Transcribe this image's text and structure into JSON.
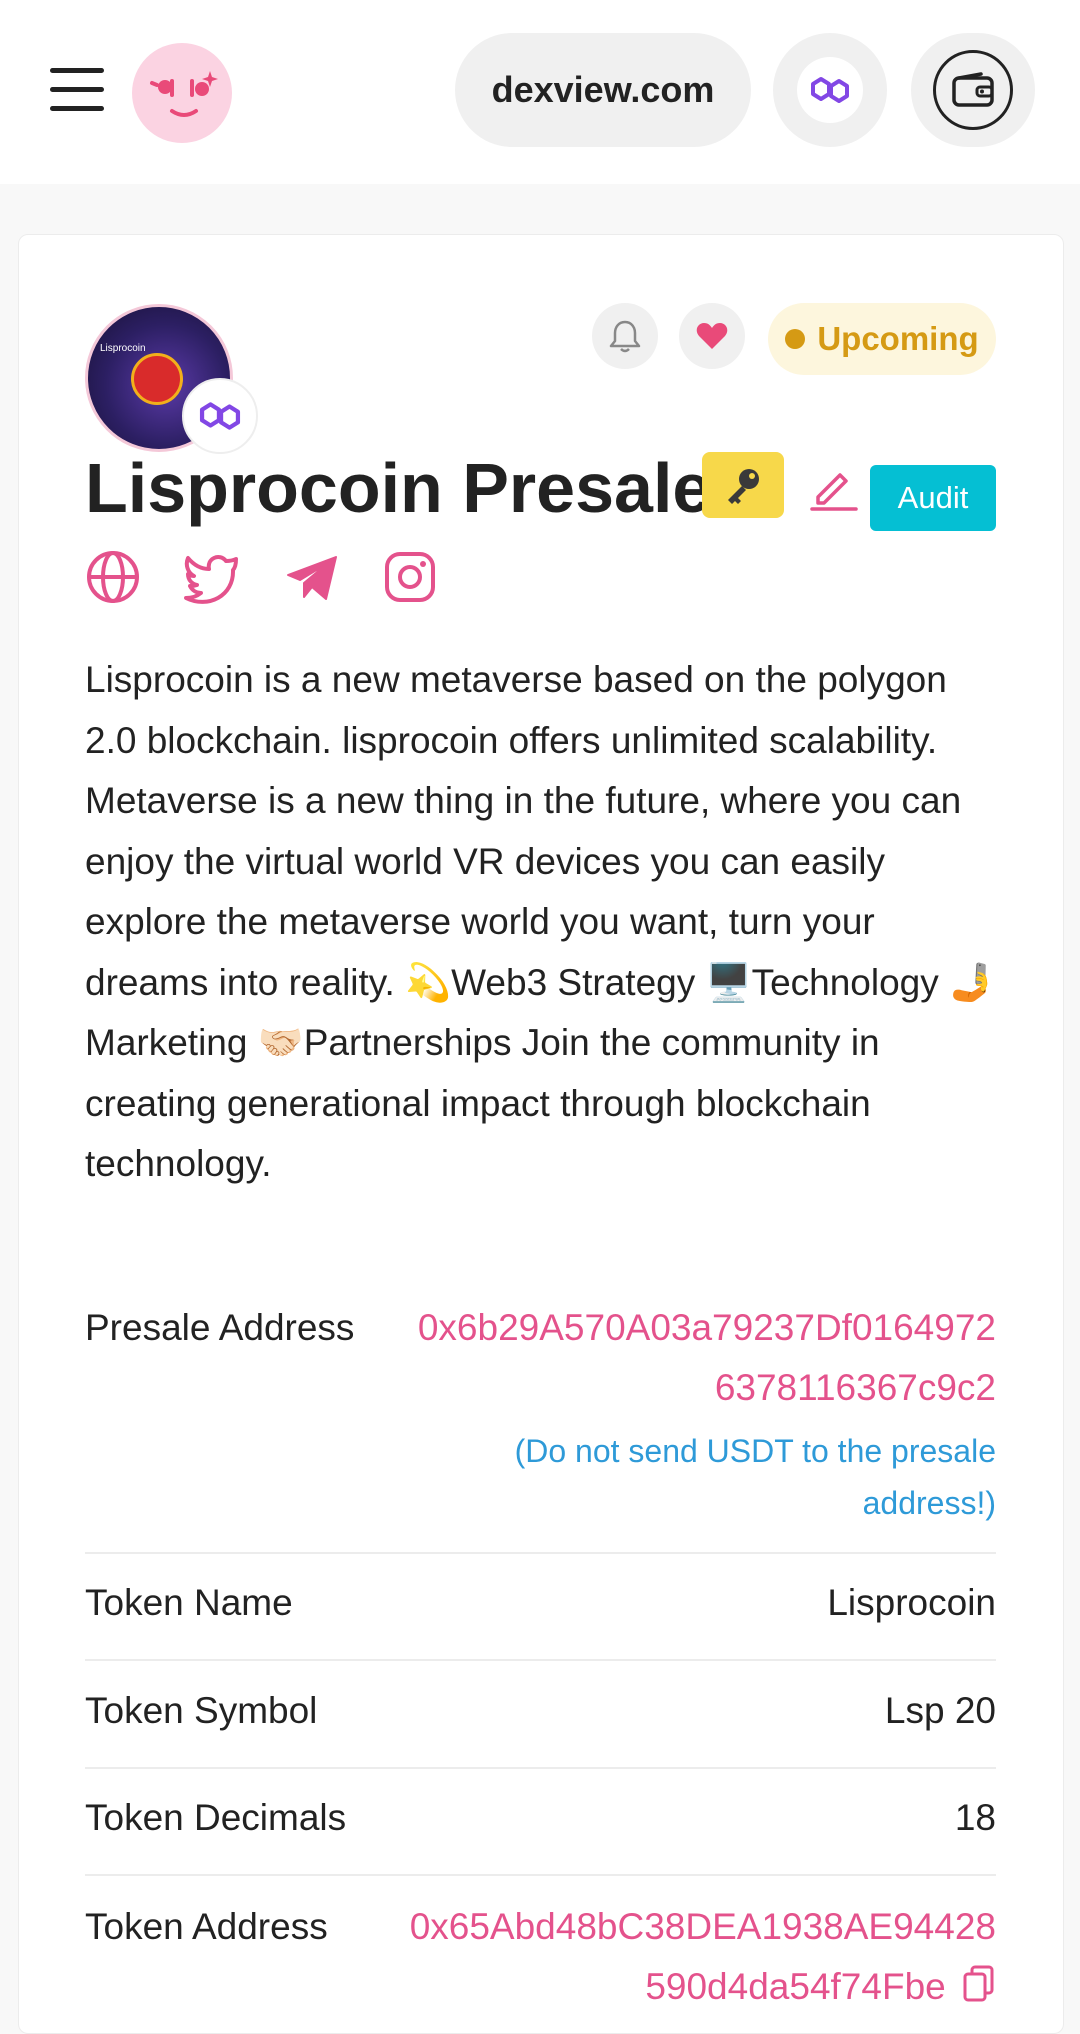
{
  "header": {
    "domain": "dexview.com",
    "menu_icon": "hamburger-menu-icon",
    "logo_icon": "smiley-face-logo-icon",
    "chain_icon": "polygon-icon",
    "wallet_icon": "wallet-icon"
  },
  "project": {
    "title": "Lisprocoin Presale",
    "logo_text": "Lisprocoin",
    "status": "Upcoming",
    "audit_label": "Audit",
    "description": "Lisprocoin is a new metaverse based on the polygon 2.0 blockchain. lisprocoin offers unlimited scalability. Metaverse is a new thing in the future, where you can enjoy the virtual world VR devices you can easily explore the metaverse world you want, turn your dreams into reality. 💫Web3 Strategy 🖥️Technology 🤳Marketing 🤝🏻Partnerships Join the community in creating generational impact through blockchain technology."
  },
  "info": {
    "presale_address_label": "Presale Address",
    "presale_address_line1": "0x6b29A570A03a79237Df0164972",
    "presale_address_line2": "6378116367c9c2",
    "presale_warning_line1": "(Do not send USDT to the presale",
    "presale_warning_line2": "address!)",
    "token_name_label": "Token Name",
    "token_name": "Lisprocoin",
    "token_symbol_label": "Token Symbol",
    "token_symbol": "Lsp 20",
    "token_decimals_label": "Token Decimals",
    "token_decimals": "18",
    "token_address_label": "Token Address",
    "token_address_line1": "0x65Abd48bC38DEA1938AE94428",
    "token_address_line2": "590d4da54f74Fbe"
  },
  "colors": {
    "accent_pink": "#e4528c",
    "status_amber": "#d59a14",
    "audit_cyan": "#05bfd3",
    "warning_blue": "#2e9ad8",
    "polygon_purple": "#8247e5",
    "key_yellow": "#f7d84a"
  }
}
